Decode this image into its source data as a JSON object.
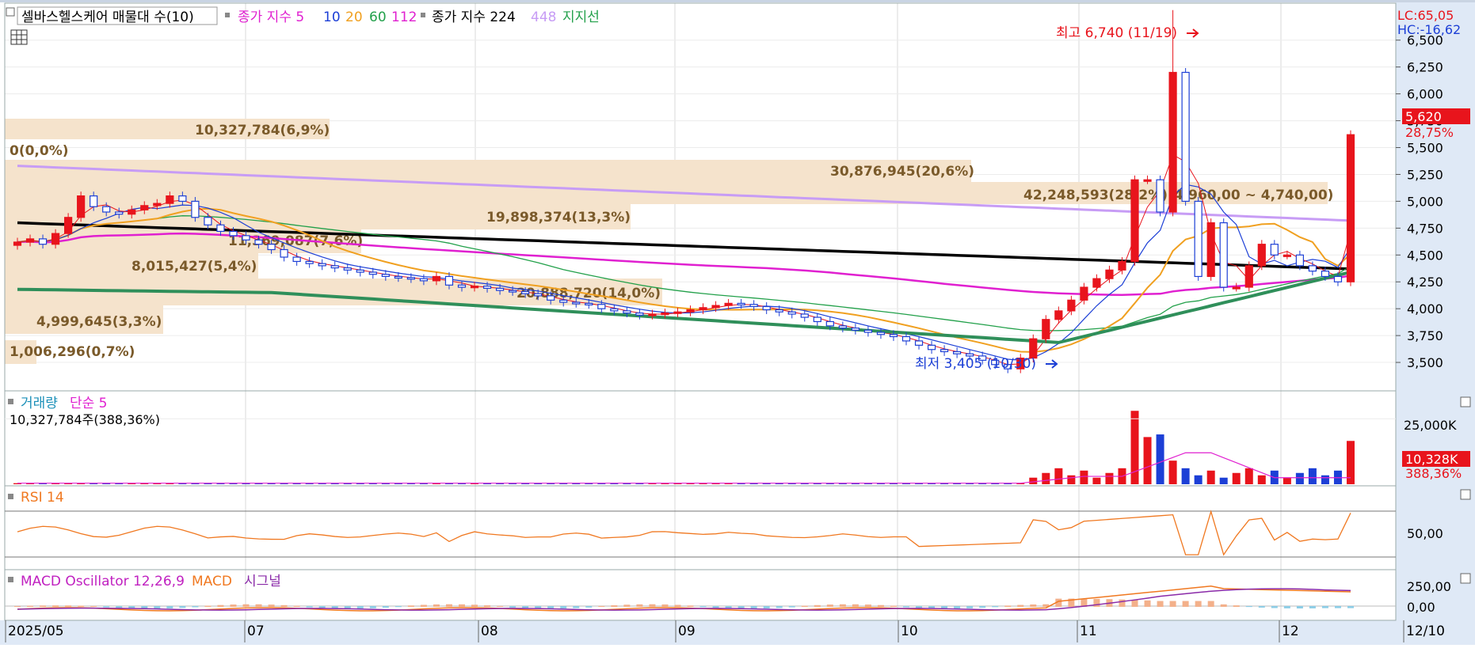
{
  "colors": {
    "up": "#e8141c",
    "down": "#1c3fd6",
    "ma5": "#e8141c",
    "ma10": "#1c3fd6",
    "ma20": "#f0a020",
    "ma60": "#22a04a",
    "ma112": "#e020d0",
    "ma224": "#000000",
    "ma448": "#c79cf5",
    "support": "#2f8f5a",
    "band": "#f5e3cc",
    "band_text": "#7a5a2a",
    "axis_bg": "#dfe9f6",
    "grid": "#d6d6d6",
    "rsi": "#f07820",
    "macd": "#f07820",
    "macd_signal": "#8a2aa8",
    "osc_pos": "#f3b08a",
    "osc_neg": "#8ccde6"
  },
  "header": {
    "title": "셀바스헬스케어 매물대 수(10)",
    "ma_label": "종가 지수 5",
    "ma_10": "10",
    "ma_20": "20",
    "ma_60": "60",
    "ma_112": "112",
    "ma2_label": "종가 지수 224",
    "ma_448": "448",
    "support_label": "지지선"
  },
  "price_axis": {
    "lc": "LC:65,05",
    "hc": "HC:-16,62",
    "ticks": [
      "6,500",
      "6,250",
      "6,000",
      "5,750",
      "5,500",
      "5,250",
      "5,000",
      "4,750",
      "4,500",
      "4,250",
      "4,000",
      "3,750",
      "3,500"
    ],
    "current_price": "5,620",
    "current_change": "28,75%"
  },
  "annotations": {
    "high": "최고 6,740 (11/19)",
    "low": "최저 3,405 (10/30)"
  },
  "volume_profile": [
    {
      "label": "0(0,0%)",
      "volume": 0,
      "pct": 0.0
    },
    {
      "label": "10,327,784(6,9%)",
      "volume": 10327784,
      "pct": 6.9
    },
    {
      "label": "30,876,945(20,6%)",
      "volume": 30876945,
      "pct": 20.6
    },
    {
      "label": "42,248,593(28,2%)(4,960,00 ~ 4,740,00)",
      "volume": 42248593,
      "pct": 28.2
    },
    {
      "label": "19,898,374(13,3%)",
      "volume": 19898374,
      "pct": 13.3
    },
    {
      "label": "11,369,087(7,6%)",
      "volume": 11369087,
      "pct": 7.6
    },
    {
      "label": "8,015,427(5,4%)",
      "volume": 8015427,
      "pct": 5.4
    },
    {
      "label": "20,888,720(14,0%)",
      "volume": 20888720,
      "pct": 14.0
    },
    {
      "label": "4,999,645(3,3%)",
      "volume": 4999645,
      "pct": 3.3
    },
    {
      "label": "1,006,296(0,7%)",
      "volume": 1006296,
      "pct": 0.7
    }
  ],
  "volume_panel": {
    "title": "거래량",
    "ma_label": "단순 5",
    "info": "10,327,784주(388,36%)",
    "tick": "25,000K",
    "current": "10,328K",
    "current_pct": "388,36%"
  },
  "rsi_panel": {
    "title": "RSI 14",
    "tick": "50,00"
  },
  "macd_panel": {
    "title": "MACD Oscillator 12,26,9",
    "macd_label": "MACD",
    "signal_label": "시그널",
    "tick_top": "250,00",
    "tick_zero": "0,00"
  },
  "x_axis": {
    "labels": [
      "2025/05",
      "07",
      "08",
      "09",
      "10",
      "11",
      "12",
      "12/10"
    ]
  },
  "chart_data": {
    "type": "candlestick",
    "price_ylim": [
      3250,
      6800
    ],
    "price_high": 6740,
    "price_low": 3405,
    "last_close": 5620,
    "close_series": [
      4620,
      4650,
      4600,
      4700,
      4850,
      5050,
      4950,
      4900,
      4880,
      4920,
      4960,
      4980,
      5050,
      5000,
      4850,
      4780,
      4720,
      4680,
      4640,
      4600,
      4550,
      4480,
      4440,
      4420,
      4400,
      4380,
      4360,
      4340,
      4320,
      4300,
      4290,
      4280,
      4260,
      4300,
      4220,
      4200,
      4210,
      4190,
      4170,
      4160,
      4140,
      4120,
      4080,
      4060,
      4050,
      4040,
      4000,
      3980,
      3960,
      3940,
      3950,
      3960,
      3970,
      3990,
      4010,
      4030,
      4050,
      4040,
      4020,
      3990,
      3970,
      3950,
      3920,
      3880,
      3840,
      3820,
      3800,
      3780,
      3760,
      3740,
      3700,
      3660,
      3620,
      3600,
      3580,
      3560,
      3520,
      3480,
      3440,
      3540,
      3720,
      3900,
      3980,
      4080,
      4200,
      4280,
      4360,
      4440,
      5200,
      5200,
      4900,
      6200,
      5000,
      4300,
      4800,
      4200,
      4200,
      4400,
      4600,
      4500,
      4500,
      4400,
      4350,
      4300,
      4250,
      5620
    ],
    "ma_448": {
      "start": 5330,
      "end": 4820
    },
    "ma_224": {
      "start": 4800,
      "end": 4370
    },
    "volume_ylim": [
      0,
      32000
    ],
    "volume_last": 10328,
    "rsi_ylim": [
      0,
      100
    ],
    "rsi_level": 50,
    "macd_ylim": [
      -100,
      320
    ]
  }
}
